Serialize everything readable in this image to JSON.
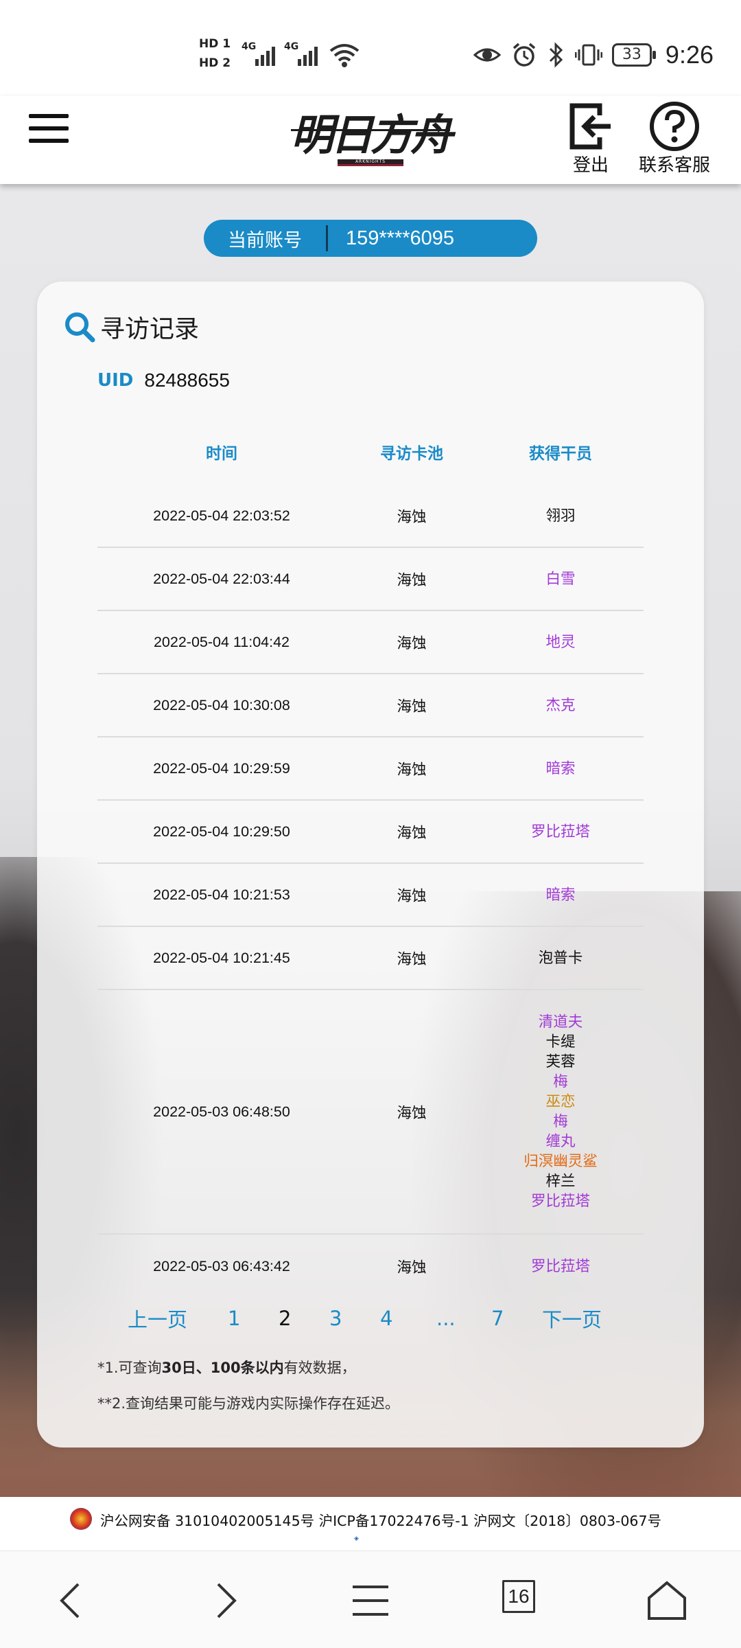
{
  "status_bar": {
    "sim1": "HD 1",
    "sim2": "HD 2",
    "net1": "4G",
    "net2": "4G",
    "battery": "33",
    "time": "9:26"
  },
  "header": {
    "logo_text": "明日方舟",
    "logo_sub": "ARKNIGHTS",
    "logout_label": "登出",
    "support_label": "联系客服"
  },
  "account": {
    "label": "当前账号",
    "value": "159****6095"
  },
  "card": {
    "title": "寻访记录",
    "uid_label": "UID",
    "uid_value": "82488655",
    "columns": [
      "时间",
      "寻访卡池",
      "获得干员"
    ],
    "rows": [
      {
        "time": "2022-05-04 22:03:52",
        "pool": "海蚀",
        "operators": [
          {
            "name": "翎羽",
            "color": "#111111"
          }
        ]
      },
      {
        "time": "2022-05-04 22:03:44",
        "pool": "海蚀",
        "operators": [
          {
            "name": "白雪",
            "color": "#a13ad6"
          }
        ]
      },
      {
        "time": "2022-05-04 11:04:42",
        "pool": "海蚀",
        "operators": [
          {
            "name": "地灵",
            "color": "#a13ad6"
          }
        ]
      },
      {
        "time": "2022-05-04 10:30:08",
        "pool": "海蚀",
        "operators": [
          {
            "name": "杰克",
            "color": "#a13ad6"
          }
        ]
      },
      {
        "time": "2022-05-04 10:29:59",
        "pool": "海蚀",
        "operators": [
          {
            "name": "暗索",
            "color": "#a13ad6"
          }
        ]
      },
      {
        "time": "2022-05-04 10:29:50",
        "pool": "海蚀",
        "operators": [
          {
            "name": "罗比菈塔",
            "color": "#a13ad6"
          }
        ]
      },
      {
        "time": "2022-05-04 10:21:53",
        "pool": "海蚀",
        "operators": [
          {
            "name": "暗索",
            "color": "#a13ad6"
          }
        ]
      },
      {
        "time": "2022-05-04 10:21:45",
        "pool": "海蚀",
        "operators": [
          {
            "name": "泡普卡",
            "color": "#111111"
          }
        ]
      },
      {
        "time": "2022-05-03 06:48:50",
        "pool": "海蚀",
        "operators": [
          {
            "name": "清道夫",
            "color": "#a13ad6"
          },
          {
            "name": "卡缇",
            "color": "#111111"
          },
          {
            "name": "芙蓉",
            "color": "#111111"
          },
          {
            "name": "梅",
            "color": "#a13ad6"
          },
          {
            "name": "巫恋",
            "color": "#cc8a12"
          },
          {
            "name": "梅",
            "color": "#a13ad6"
          },
          {
            "name": "缠丸",
            "color": "#a13ad6"
          },
          {
            "name": "归溟幽灵鲨",
            "color": "#e26a14"
          },
          {
            "name": "梓兰",
            "color": "#111111"
          },
          {
            "name": "罗比菈塔",
            "color": "#a13ad6"
          }
        ]
      },
      {
        "time": "2022-05-03 06:43:42",
        "pool": "海蚀",
        "operators": [
          {
            "name": "罗比菈塔",
            "color": "#a13ad6"
          }
        ]
      }
    ]
  },
  "pagination": {
    "prev": "上一页",
    "pages": [
      "1",
      "2",
      "3",
      "4",
      "...",
      "7"
    ],
    "current": "2",
    "next": "下一页"
  },
  "notes": {
    "note1_prefix": "*1.可查询",
    "note1_bold": "30日、100条以内",
    "note1_suffix": "有效数据，",
    "note2": "**2.查询结果可能与游戏内实际操作存在延迟。"
  },
  "footer": {
    "license": "沪公网安备 31010402005145号  沪ICP备17022476号-1  沪网文〔2018〕0803-067号"
  },
  "browser_nav": {
    "tab_count": "16"
  },
  "colors": {
    "accent": "#1a8bc7",
    "rare4": "#a13ad6",
    "rare5": "#cc8a12",
    "rare6": "#e26a14"
  }
}
